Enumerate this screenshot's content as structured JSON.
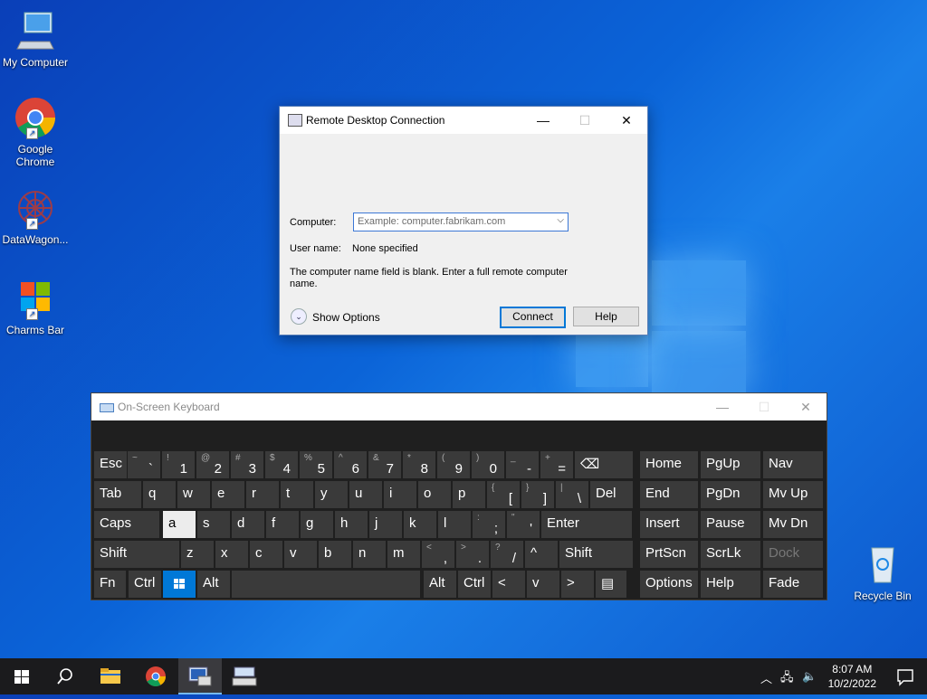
{
  "desktop": {
    "icons": [
      {
        "label": "My Computer",
        "icon": "computer-icon"
      },
      {
        "label": "Google Chrome",
        "icon": "chrome-icon"
      },
      {
        "label": "DataWagon...",
        "icon": "datawagon-icon"
      },
      {
        "label": "Charms Bar",
        "icon": "windows-logo-icon"
      },
      {
        "label": "Recycle Bin",
        "icon": "recycle-bin-icon"
      }
    ]
  },
  "rdc": {
    "title": "Remote Desktop Connection",
    "computer_label": "Computer:",
    "computer_placeholder": "Example: computer.fabrikam.com",
    "username_label": "User name:",
    "username_value": "None specified",
    "message": "The computer name field is blank. Enter a full remote computer name.",
    "show_options": "Show Options",
    "connect": "Connect",
    "help": "Help"
  },
  "osk": {
    "title": "On-Screen Keyboard",
    "row1": [
      {
        "m": "Esc"
      },
      {
        "s": "~",
        "b": "`"
      },
      {
        "s": "!",
        "b": "1"
      },
      {
        "s": "@",
        "b": "2"
      },
      {
        "s": "#",
        "b": "3"
      },
      {
        "s": "$",
        "b": "4"
      },
      {
        "s": "%",
        "b": "5"
      },
      {
        "s": "^",
        "b": "6"
      },
      {
        "s": "&",
        "b": "7"
      },
      {
        "s": "*",
        "b": "8"
      },
      {
        "s": "(",
        "b": "9"
      },
      {
        "s": ")",
        "b": "0"
      },
      {
        "s": "_",
        "b": "-"
      },
      {
        "s": "+",
        "b": "="
      },
      {
        "m": "⌫"
      },
      {
        "m": "Home"
      },
      {
        "m": "PgUp"
      },
      {
        "m": "Nav"
      }
    ],
    "row2": [
      {
        "m": "Tab"
      },
      {
        "m": "q"
      },
      {
        "m": "w"
      },
      {
        "m": "e"
      },
      {
        "m": "r"
      },
      {
        "m": "t"
      },
      {
        "m": "y"
      },
      {
        "m": "u"
      },
      {
        "m": "i"
      },
      {
        "m": "o"
      },
      {
        "m": "p"
      },
      {
        "s": "{",
        "b": "["
      },
      {
        "s": "}",
        "b": "]"
      },
      {
        "s": "|",
        "b": "\\"
      },
      {
        "m": "Del"
      },
      {
        "m": "End"
      },
      {
        "m": "PgDn"
      },
      {
        "m": "Mv Up"
      }
    ],
    "row3": [
      {
        "m": "Caps"
      },
      {
        "m": "a"
      },
      {
        "m": "s"
      },
      {
        "m": "d"
      },
      {
        "m": "f"
      },
      {
        "m": "g"
      },
      {
        "m": "h"
      },
      {
        "m": "j"
      },
      {
        "m": "k"
      },
      {
        "m": "l"
      },
      {
        "s": ":",
        "b": ";"
      },
      {
        "s": "\"",
        "b": "'"
      },
      {
        "m": "Enter"
      },
      {
        "m": "Insert"
      },
      {
        "m": "Pause"
      },
      {
        "m": "Mv Dn"
      }
    ],
    "row4": [
      {
        "m": "Shift"
      },
      {
        "m": "z"
      },
      {
        "m": "x"
      },
      {
        "m": "c"
      },
      {
        "m": "v"
      },
      {
        "m": "b"
      },
      {
        "m": "n"
      },
      {
        "m": "m"
      },
      {
        "s": "<",
        "b": ","
      },
      {
        "s": ">",
        "b": "."
      },
      {
        "s": "?",
        "b": "/"
      },
      {
        "m": "^"
      },
      {
        "m": "Shift"
      },
      {
        "m": "PrtScn"
      },
      {
        "m": "ScrLk"
      },
      {
        "m": "Dock"
      }
    ],
    "row5": [
      {
        "m": "Fn"
      },
      {
        "m": "Ctrl"
      },
      {
        "m": "win"
      },
      {
        "m": "Alt"
      },
      {
        "m": ""
      },
      {
        "m": "Alt"
      },
      {
        "m": "Ctrl"
      },
      {
        "m": "<"
      },
      {
        "m": "v"
      },
      {
        "m": ">"
      },
      {
        "m": "▤"
      },
      {
        "m": "Options"
      },
      {
        "m": "Help"
      },
      {
        "m": "Fade"
      }
    ]
  },
  "taskbar": {
    "time": "8:07 AM",
    "date": "10/2/2022"
  }
}
